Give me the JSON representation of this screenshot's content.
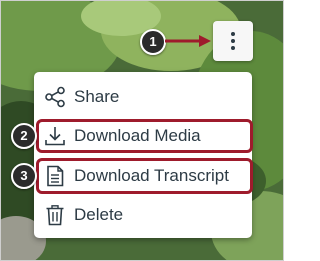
{
  "menu": {
    "items": [
      {
        "label": "Share",
        "icon": "share-icon"
      },
      {
        "label": "Download Media",
        "icon": "download-icon"
      },
      {
        "label": "Download Transcript",
        "icon": "transcript-icon"
      },
      {
        "label": "Delete",
        "icon": "trash-icon"
      }
    ]
  },
  "trigger": {
    "icon": "more-vertical-icon"
  },
  "callouts": [
    "1",
    "2",
    "3"
  ],
  "colors": {
    "highlight": "#9e1b2c",
    "callout_bg": "#2b2b2b",
    "menu_text": "#2d3b45",
    "menu_bg": "#ffffff"
  }
}
